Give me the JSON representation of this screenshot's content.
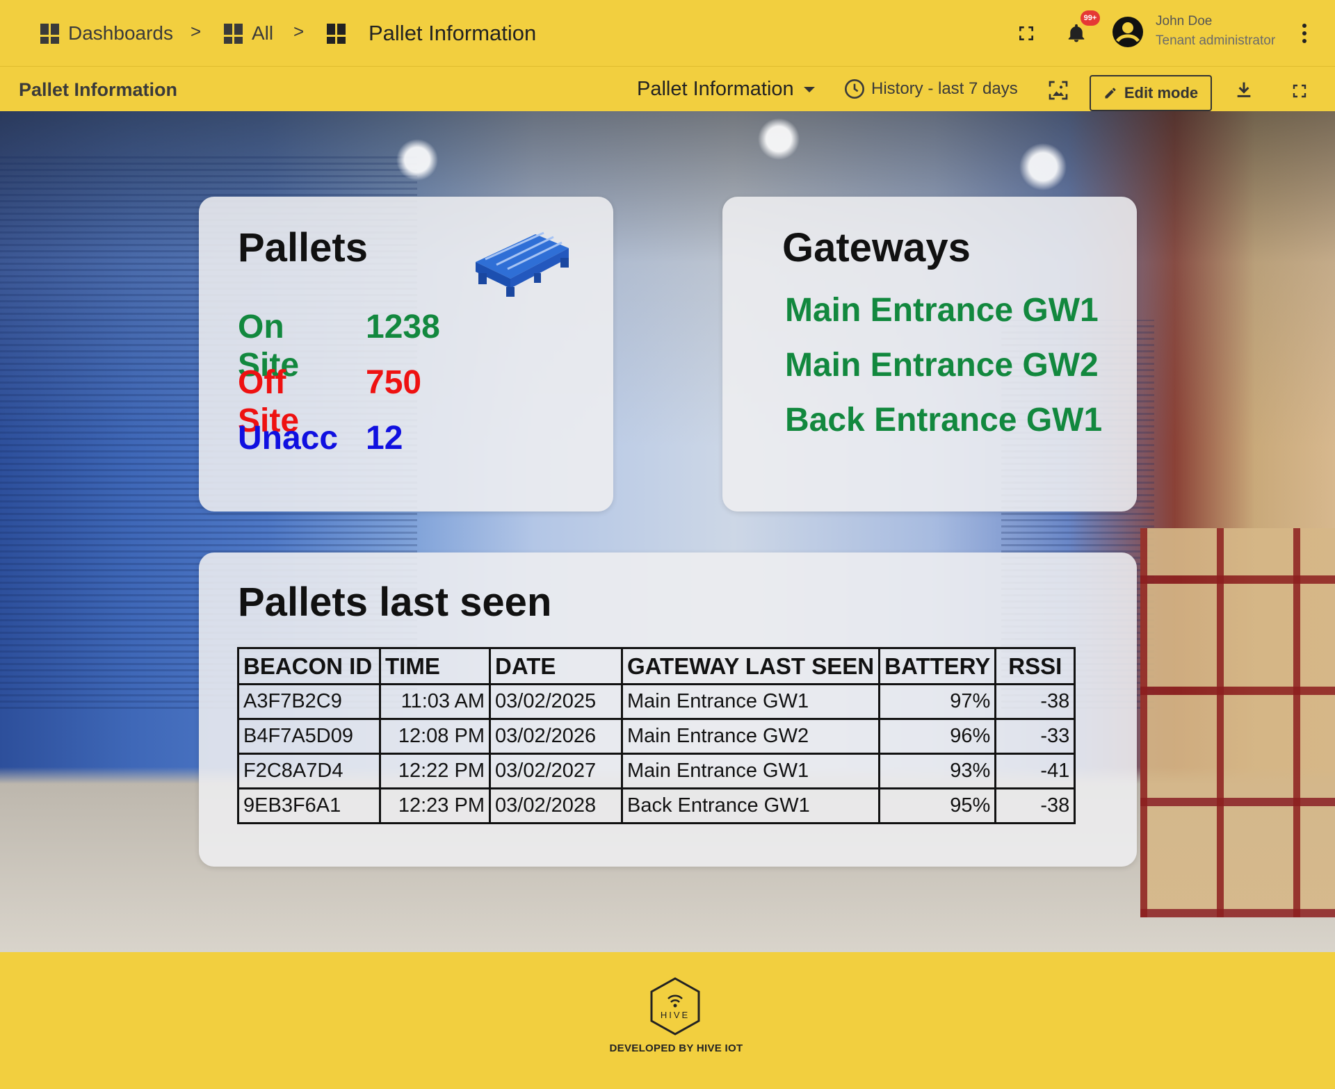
{
  "topbar": {
    "breadcrumbs": [
      "Dashboards",
      "All",
      "Pallet Information"
    ],
    "separator": ">",
    "notification_badge": "99+",
    "user": {
      "name": "John Doe",
      "role": "Tenant administrator"
    }
  },
  "subbar": {
    "title": "Pallet Information",
    "state_select": "Pallet Information",
    "history": "History - last 7 days",
    "edit_mode": "Edit mode"
  },
  "pallets_card": {
    "title": "Pallets",
    "stats": [
      {
        "label": "On Site",
        "value": "1238",
        "color": "#12883e"
      },
      {
        "label": "Off Site",
        "value": "750",
        "color": "#ee1111"
      },
      {
        "label": "Unacc",
        "value": "12",
        "color": "#1010e0"
      }
    ]
  },
  "gateways_card": {
    "title": "Gateways",
    "items": [
      "Main Entrance GW1",
      "Main Entrance GW2",
      "Back Entrance GW1"
    ]
  },
  "last_seen_card": {
    "title": "Pallets last seen",
    "columns": [
      "BEACON ID",
      "TIME",
      "DATE",
      "GATEWAY LAST SEEN",
      "BATTERY",
      "RSSI"
    ],
    "rows": [
      [
        "A3F7B2C9",
        "11:03 AM",
        "03/02/2025",
        "Main Entrance GW1",
        "97%",
        "-38"
      ],
      [
        "B4F7A5D09",
        "12:08 PM",
        "03/02/2026",
        "Main Entrance GW2",
        "96%",
        "-33"
      ],
      [
        "F2C8A7D4",
        "12:22 PM",
        "03/02/2027",
        "Main Entrance GW1",
        "93%",
        "-41"
      ],
      [
        "9EB3F6A1",
        "12:23 PM",
        "03/02/2028",
        "Back Entrance GW1",
        "95%",
        "-38"
      ]
    ]
  },
  "footer": {
    "logo_text": "HIVE",
    "developed_by": "DEVELOPED BY HIVE IOT"
  },
  "colors": {
    "brand_yellow": "#f2cf3f",
    "on_site": "#12883e",
    "off_site": "#ee1111",
    "unaccounted": "#1010e0",
    "gateway_green": "#12883e"
  }
}
